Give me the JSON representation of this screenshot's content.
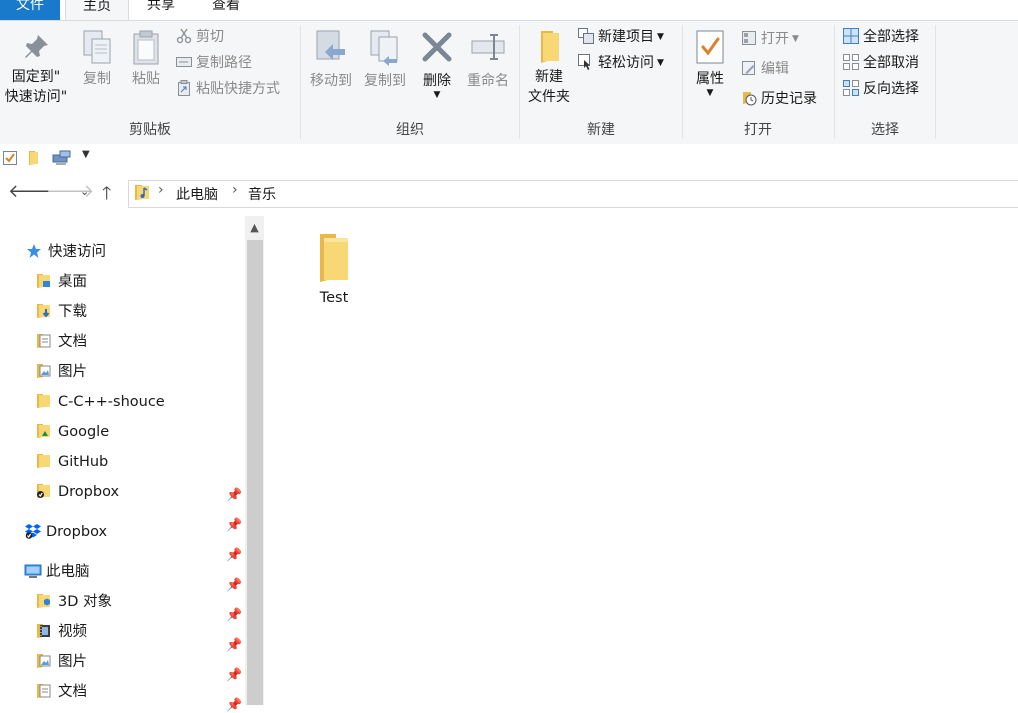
{
  "ribbon_tabs": [
    {
      "label": "文件"
    },
    {
      "label": "主页"
    },
    {
      "label": "共享"
    },
    {
      "label": "查看"
    }
  ],
  "clipboard": {
    "group_label": "剪贴板",
    "pin_label_1": "固定到\"",
    "pin_label_2": "快速访问\"",
    "copy_label": "复制",
    "paste_label": "粘贴",
    "cut_label": "剪切",
    "copy_path_label": "复制路径",
    "paste_shortcut_label": "粘贴快捷方式"
  },
  "organize": {
    "group_label": "组织",
    "move_to_label": "移动到",
    "copy_to_label": "复制到",
    "delete_label": "删除",
    "rename_label": "重命名"
  },
  "new": {
    "group_label": "新建",
    "new_folder_label_1": "新建",
    "new_folder_label_2": "文件夹",
    "new_item_label": "新建项目",
    "easy_access_label": "轻松访问"
  },
  "open": {
    "group_label": "打开",
    "properties_label": "属性",
    "open_label": "打开",
    "edit_label": "编辑",
    "history_label": "历史记录"
  },
  "select": {
    "group_label": "选择",
    "select_all_label": "全部选择",
    "select_none_label": "全部取消",
    "invert_label": "反向选择"
  },
  "address": {
    "crumbs": [
      "此电脑",
      "音乐"
    ]
  },
  "nav": {
    "quick_access_label": "快速访问",
    "quick_items": [
      {
        "label": "桌面",
        "icon": "desktop-folder"
      },
      {
        "label": "下载",
        "icon": "downloads-folder"
      },
      {
        "label": "文档",
        "icon": "documents-folder"
      },
      {
        "label": "图片",
        "icon": "pictures-folder"
      },
      {
        "label": "C-C++-shouce",
        "icon": "folder"
      },
      {
        "label": "Google",
        "icon": "google-drive-folder"
      },
      {
        "label": "GitHub",
        "icon": "folder"
      },
      {
        "label": "Dropbox",
        "icon": "dropbox-folder"
      }
    ],
    "dropbox_label": "Dropbox",
    "this_pc_label": "此电脑",
    "pc_items": [
      {
        "label": "3D 对象",
        "icon": "3d-objects-folder"
      },
      {
        "label": "视频",
        "icon": "videos-folder"
      },
      {
        "label": "图片",
        "icon": "pictures-folder"
      },
      {
        "label": "文档",
        "icon": "documents-folder"
      }
    ]
  },
  "content": {
    "items": [
      {
        "label": "Test",
        "icon": "folder"
      }
    ]
  },
  "colors": {
    "file_tab_bg": "#1979ca",
    "folder_yellow": "#f8d775",
    "ribbon_bg": "#f5f6f7"
  }
}
